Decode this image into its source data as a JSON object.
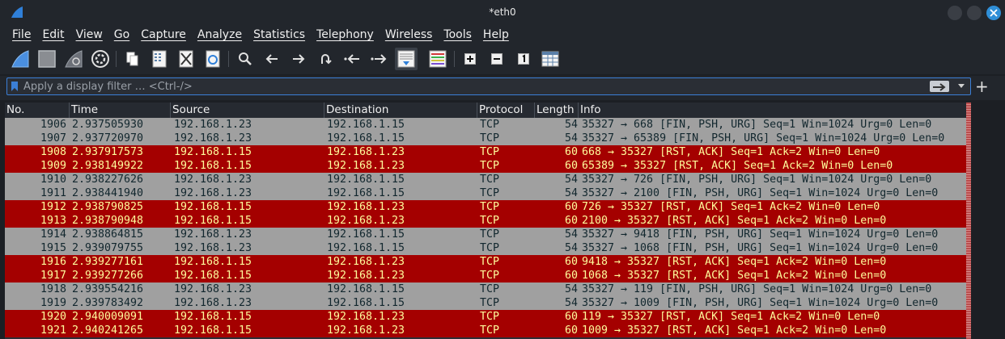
{
  "window": {
    "title": "*eth0"
  },
  "menu": [
    "File",
    "Edit",
    "View",
    "Go",
    "Capture",
    "Analyze",
    "Statistics",
    "Telephony",
    "Wireless",
    "Tools",
    "Help"
  ],
  "toolbar": {
    "icons": [
      "shark-fin-start-icon",
      "stop-square-icon",
      "restart-fin-icon",
      "capture-options-gear-icon",
      "open-file-icon",
      "save-file-icon",
      "close-file-icon",
      "reload-file-icon",
      "search-icon",
      "back-arrow-icon",
      "forward-arrow-icon",
      "go-to-packet-icon",
      "first-packet-icon",
      "last-packet-icon",
      "autoscroll-icon",
      "colorize-icon",
      "zoom-in-icon",
      "zoom-out-icon",
      "normal-size-icon",
      "resize-columns-icon"
    ]
  },
  "filter": {
    "placeholder": "Apply a display filter … <Ctrl-/>",
    "value": ""
  },
  "packet_list": {
    "columns": [
      "No.",
      "Time",
      "Source",
      "Destination",
      "Protocol",
      "Length",
      "Info"
    ],
    "rows": [
      {
        "no": "1906",
        "time": "2.937505930",
        "src": "192.168.1.23",
        "dst": "192.168.1.15",
        "proto": "TCP",
        "len": "54",
        "info": "35327 → 668 [FIN, PSH, URG] Seq=1 Win=1024 Urg=0 Len=0",
        "color": "gray"
      },
      {
        "no": "1907",
        "time": "2.937720970",
        "src": "192.168.1.23",
        "dst": "192.168.1.15",
        "proto": "TCP",
        "len": "54",
        "info": "35327 → 65389 [FIN, PSH, URG] Seq=1 Win=1024 Urg=0 Len=0",
        "color": "gray"
      },
      {
        "no": "1908",
        "time": "2.937917573",
        "src": "192.168.1.15",
        "dst": "192.168.1.23",
        "proto": "TCP",
        "len": "60",
        "info": "668 → 35327 [RST, ACK] Seq=1 Ack=2 Win=0 Len=0",
        "color": "red"
      },
      {
        "no": "1909",
        "time": "2.938149922",
        "src": "192.168.1.15",
        "dst": "192.168.1.23",
        "proto": "TCP",
        "len": "60",
        "info": "65389 → 35327 [RST, ACK] Seq=1 Ack=2 Win=0 Len=0",
        "color": "red"
      },
      {
        "no": "1910",
        "time": "2.938227626",
        "src": "192.168.1.23",
        "dst": "192.168.1.15",
        "proto": "TCP",
        "len": "54",
        "info": "35327 → 726 [FIN, PSH, URG] Seq=1 Win=1024 Urg=0 Len=0",
        "color": "gray"
      },
      {
        "no": "1911",
        "time": "2.938441940",
        "src": "192.168.1.23",
        "dst": "192.168.1.15",
        "proto": "TCP",
        "len": "54",
        "info": "35327 → 2100 [FIN, PSH, URG] Seq=1 Win=1024 Urg=0 Len=0",
        "color": "gray"
      },
      {
        "no": "1912",
        "time": "2.938790825",
        "src": "192.168.1.15",
        "dst": "192.168.1.23",
        "proto": "TCP",
        "len": "60",
        "info": "726 → 35327 [RST, ACK] Seq=1 Ack=2 Win=0 Len=0",
        "color": "red"
      },
      {
        "no": "1913",
        "time": "2.938790948",
        "src": "192.168.1.15",
        "dst": "192.168.1.23",
        "proto": "TCP",
        "len": "60",
        "info": "2100 → 35327 [RST, ACK] Seq=1 Ack=2 Win=0 Len=0",
        "color": "red"
      },
      {
        "no": "1914",
        "time": "2.938864815",
        "src": "192.168.1.23",
        "dst": "192.168.1.15",
        "proto": "TCP",
        "len": "54",
        "info": "35327 → 9418 [FIN, PSH, URG] Seq=1 Win=1024 Urg=0 Len=0",
        "color": "gray"
      },
      {
        "no": "1915",
        "time": "2.939079755",
        "src": "192.168.1.23",
        "dst": "192.168.1.15",
        "proto": "TCP",
        "len": "54",
        "info": "35327 → 1068 [FIN, PSH, URG] Seq=1 Win=1024 Urg=0 Len=0",
        "color": "gray"
      },
      {
        "no": "1916",
        "time": "2.939277161",
        "src": "192.168.1.15",
        "dst": "192.168.1.23",
        "proto": "TCP",
        "len": "60",
        "info": "9418 → 35327 [RST, ACK] Seq=1 Ack=2 Win=0 Len=0",
        "color": "red"
      },
      {
        "no": "1917",
        "time": "2.939277266",
        "src": "192.168.1.15",
        "dst": "192.168.1.23",
        "proto": "TCP",
        "len": "60",
        "info": "1068 → 35327 [RST, ACK] Seq=1 Ack=2 Win=0 Len=0",
        "color": "red"
      },
      {
        "no": "1918",
        "time": "2.939554216",
        "src": "192.168.1.23",
        "dst": "192.168.1.15",
        "proto": "TCP",
        "len": "54",
        "info": "35327 → 119 [FIN, PSH, URG] Seq=1 Win=1024 Urg=0 Len=0",
        "color": "gray"
      },
      {
        "no": "1919",
        "time": "2.939783492",
        "src": "192.168.1.23",
        "dst": "192.168.1.15",
        "proto": "TCP",
        "len": "54",
        "info": "35327 → 1009 [FIN, PSH, URG] Seq=1 Win=1024 Urg=0 Len=0",
        "color": "gray"
      },
      {
        "no": "1920",
        "time": "2.940009091",
        "src": "192.168.1.15",
        "dst": "192.168.1.23",
        "proto": "TCP",
        "len": "60",
        "info": "119 → 35327 [RST, ACK] Seq=1 Ack=2 Win=0 Len=0",
        "color": "red"
      },
      {
        "no": "1921",
        "time": "2.940241265",
        "src": "192.168.1.15",
        "dst": "192.168.1.23",
        "proto": "TCP",
        "len": "60",
        "info": "1009 → 35327 [RST, ACK] Seq=1 Ack=2 Win=0 Len=0",
        "color": "red"
      }
    ]
  },
  "colors": {
    "row_gray": "#a0a0a0",
    "row_red": "#a40000",
    "red_text": "#fffc9c",
    "gray_text": "#12272e",
    "accent": "#2f8fd8"
  }
}
